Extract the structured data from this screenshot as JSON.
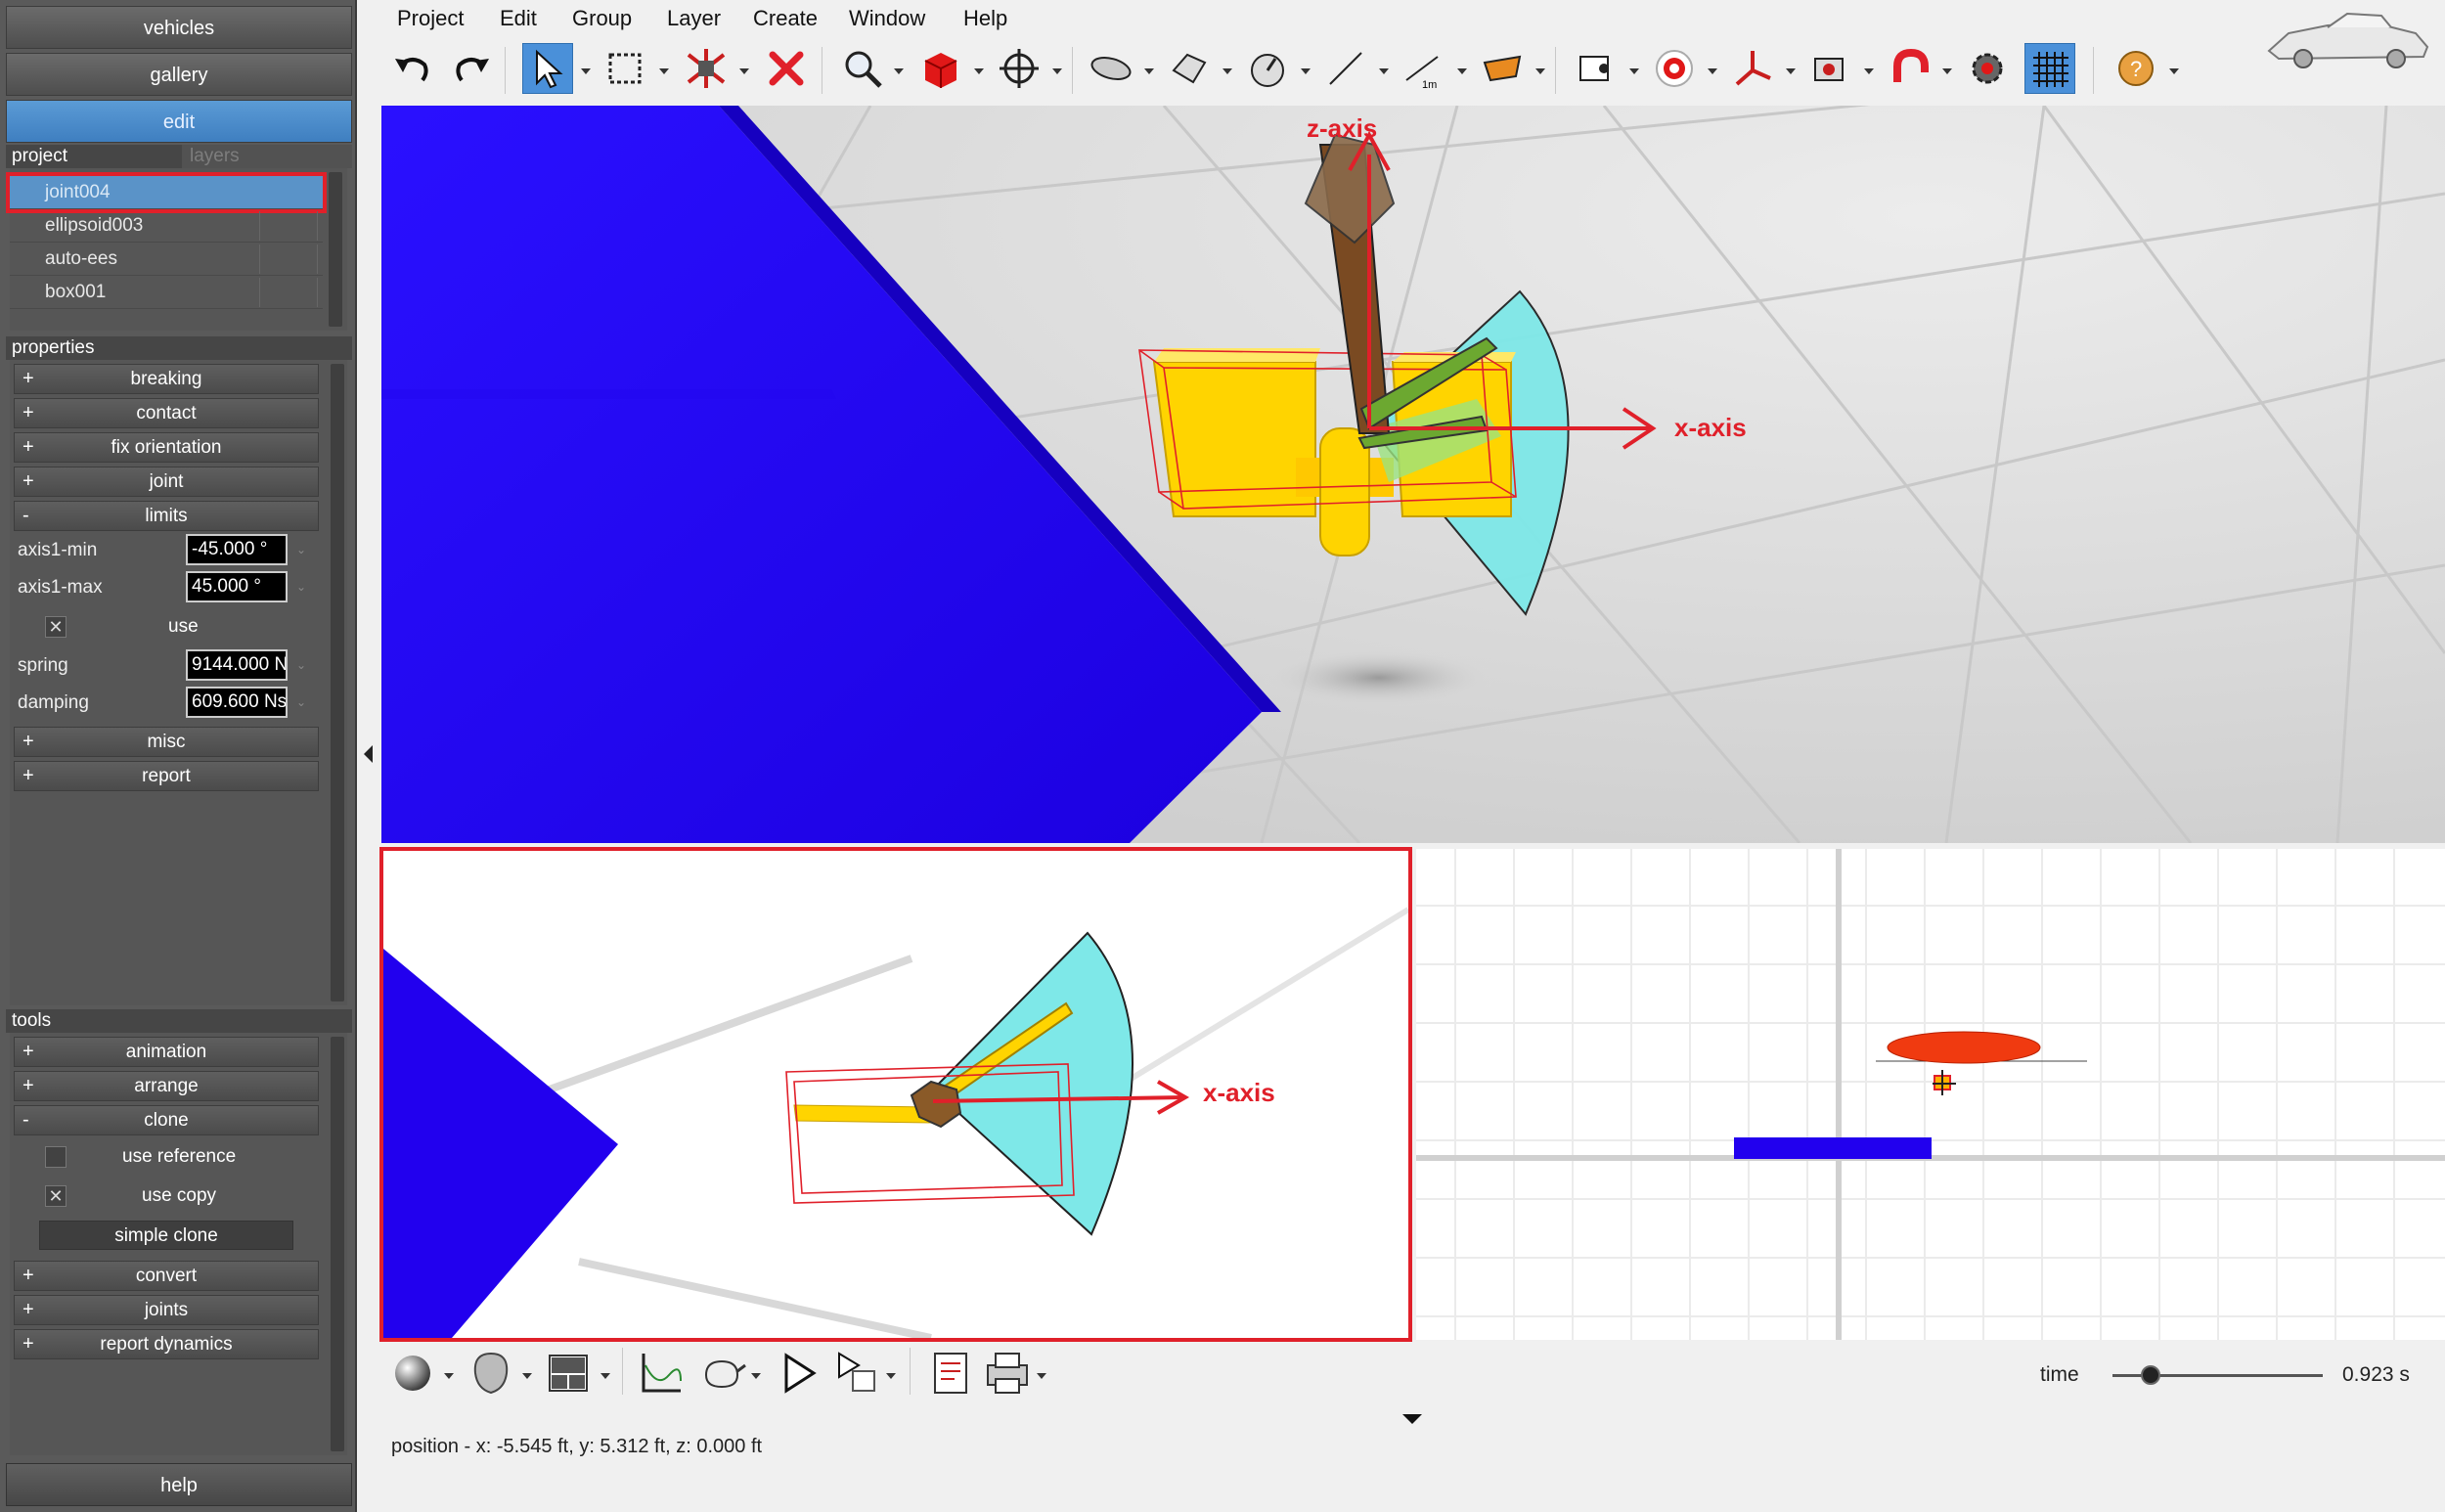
{
  "nav": {
    "vehicles": "vehicles",
    "gallery": "gallery",
    "edit": "edit"
  },
  "project": {
    "tab_project": "project",
    "tab_layers": "layers",
    "items": [
      {
        "label": "joint004",
        "selected": true
      },
      {
        "label": "ellipsoid003",
        "selected": false
      },
      {
        "label": "auto-ees",
        "selected": false
      },
      {
        "label": "box001",
        "selected": false
      }
    ]
  },
  "properties": {
    "header": "properties",
    "groups": [
      {
        "sign": "+",
        "label": "breaking"
      },
      {
        "sign": "+",
        "label": "contact"
      },
      {
        "sign": "+",
        "label": "fix orientation"
      },
      {
        "sign": "+",
        "label": "joint"
      },
      {
        "sign": "-",
        "label": "limits"
      }
    ],
    "limits": {
      "axis1_min_label": "axis1-min",
      "axis1_min_value": "-45.000 °",
      "axis1_max_label": "axis1-max",
      "axis1_max_value": "45.000 °",
      "use_label": "use",
      "use_checked": true,
      "spring_label": "spring",
      "spring_value": "9144.000 N",
      "damping_label": "damping",
      "damping_value": "609.600 Ns"
    },
    "groups_after": [
      {
        "sign": "+",
        "label": "misc"
      },
      {
        "sign": "+",
        "label": "report"
      }
    ]
  },
  "tools": {
    "header": "tools",
    "groups": [
      {
        "sign": "+",
        "label": "animation"
      },
      {
        "sign": "+",
        "label": "arrange"
      },
      {
        "sign": "-",
        "label": "clone"
      }
    ],
    "clone": {
      "use_reference_label": "use reference",
      "use_reference_checked": false,
      "use_copy_label": "use copy",
      "use_copy_checked": true,
      "simple_clone_label": "simple clone"
    },
    "groups_after": [
      {
        "sign": "+",
        "label": "convert"
      },
      {
        "sign": "+",
        "label": "joints"
      },
      {
        "sign": "+",
        "label": "report dynamics"
      }
    ]
  },
  "help": "help",
  "menu": [
    "Project",
    "Edit",
    "Group",
    "Layer",
    "Create",
    "Window",
    "Help"
  ],
  "toolbar_icons": [
    "undo-icon",
    "redo-icon",
    "select-arrow-icon",
    "select-rect-icon",
    "explode-icon",
    "delete-icon",
    "zoom-icon",
    "box-icon",
    "move-icon",
    "ellipsoid-icon",
    "plane-icon",
    "joint-icon",
    "line-icon",
    "measure-icon",
    "mesh-icon",
    "camera-icon",
    "target-icon",
    "axes-icon",
    "sensor-icon",
    "magnet-icon",
    "gear-icon",
    "grid-icon",
    "help-icon"
  ],
  "annotations": {
    "main_z_axis": "z-axis",
    "main_x_axis": "x-axis",
    "top_x_axis": "x-axis"
  },
  "bottom_icons": [
    "sphere-shading-icon",
    "head-icon",
    "layout-icon",
    "graph-icon",
    "teapot-icon",
    "play-icon",
    "play-options-icon",
    "report-icon",
    "print-icon"
  ],
  "time": {
    "label": "time",
    "value": "0.923 s",
    "fraction": 0.18
  },
  "status": "position - x: -5.545 ft, y: 5.312 ft, z: 0.000 ft",
  "colors": {
    "accent": "#4a90d9",
    "annotation_red": "#e0202a",
    "floor_blue": "#2200ee",
    "joint_yellow": "#ffd400",
    "limit_cyan": "#7ee8e8"
  }
}
